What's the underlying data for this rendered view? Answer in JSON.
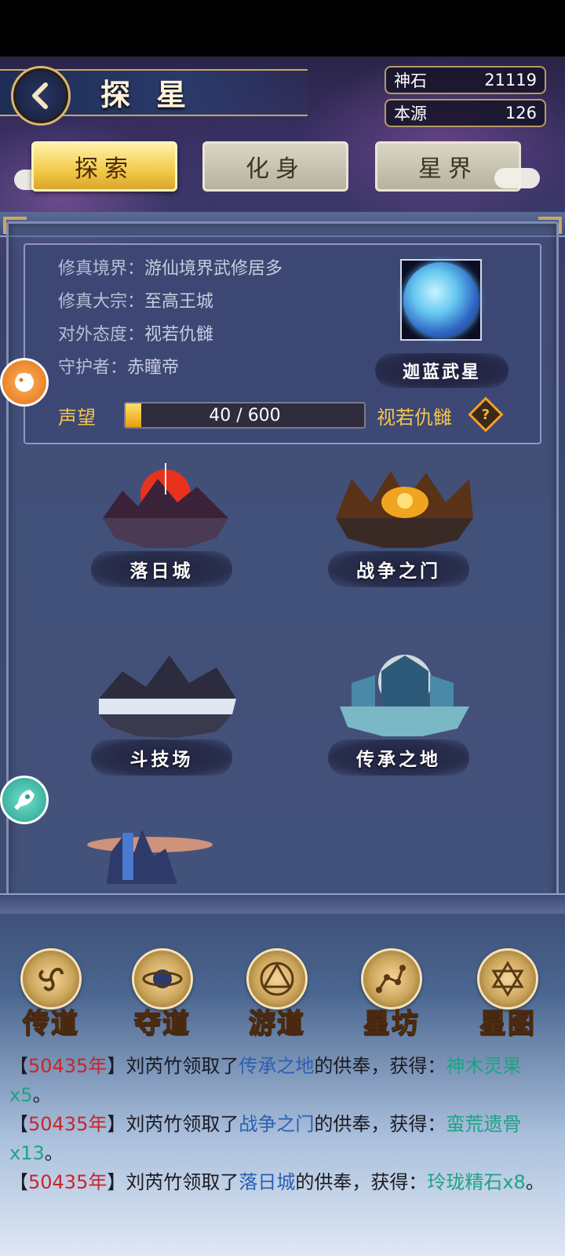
{
  "header": {
    "title": "探 星",
    "resources": [
      {
        "label": "神石",
        "value": "21119"
      },
      {
        "label": "本源",
        "value": "126"
      }
    ]
  },
  "tabs": [
    {
      "label": "探索",
      "active": true
    },
    {
      "label": "化身",
      "active": false
    },
    {
      "label": "星界",
      "active": false
    }
  ],
  "info": {
    "realm_label": "修真境界：",
    "realm_value": "游仙境界武修居多",
    "sect_label": "修真大宗：",
    "sect_value": "至高王城",
    "attitude_label": "对外态度：",
    "attitude_value": "视若仇雠",
    "guardian_label": "守护者：",
    "guardian_value": "赤瞳帝",
    "planet_name": "迦蓝武星",
    "reputation_label": "声望",
    "reputation_current": 40,
    "reputation_max": 600,
    "reputation_text": "40 / 600",
    "reputation_status": "视若仇雠",
    "help_symbol": "?"
  },
  "locations": [
    {
      "name": "落日城"
    },
    {
      "name": "战争之门"
    },
    {
      "name": "斗技场"
    },
    {
      "name": "传承之地"
    }
  ],
  "nav": [
    {
      "label": "传道",
      "icon": "triskelion-icon"
    },
    {
      "label": "夺道",
      "icon": "planet-orbit-icon"
    },
    {
      "label": "游道",
      "icon": "trinity-knot-icon"
    },
    {
      "label": "星坊",
      "icon": "constellation-icon"
    },
    {
      "label": "星图",
      "icon": "hexagram-icon"
    }
  ],
  "log": [
    {
      "open": "【",
      "year": "50435年",
      "close": "】",
      "text1": "刘芮竹领取了",
      "place": "传承之地",
      "text2": "的供奉，获得：",
      "item": "神木灵果x5",
      "end": "。"
    },
    {
      "open": "【",
      "year": "50435年",
      "close": "】",
      "text1": "刘芮竹领取了",
      "place": "战争之门",
      "text2": "的供奉，获得：",
      "item": "蛮荒遗骨x13",
      "end": "。"
    },
    {
      "open": "【",
      "year": "50435年",
      "close": "】",
      "text1": "刘芮竹领取了",
      "place": "落日城",
      "text2": "的供奉，获得：",
      "item": "玲珑精石x8",
      "end": "。"
    }
  ],
  "colors": {
    "accent_gold": "#f3c44b",
    "year_red": "#c8262a",
    "place_blue": "#2a5fb4",
    "item_green": "#1ea383"
  }
}
